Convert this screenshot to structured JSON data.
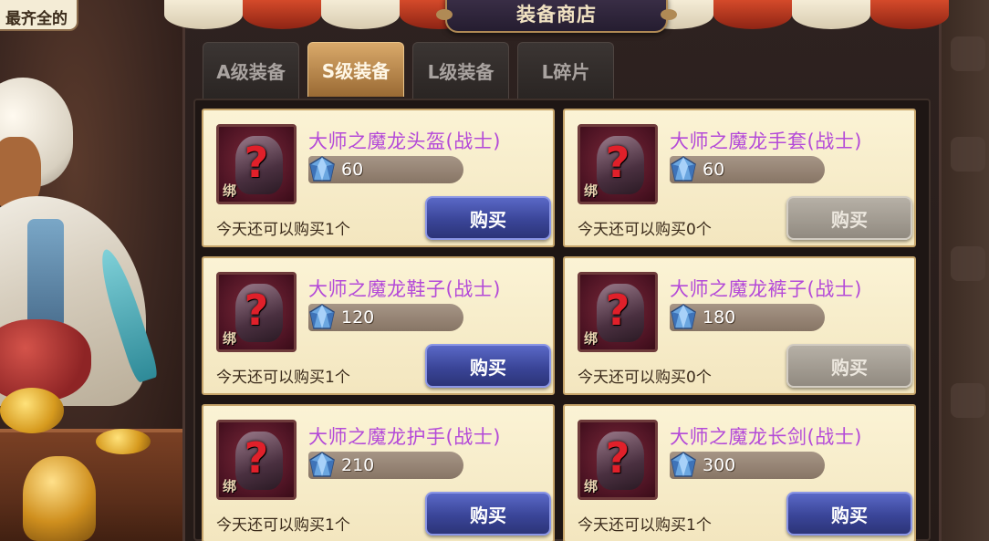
{
  "tooltip": "最齐全的",
  "title": "装备商店",
  "tabs": [
    {
      "label": "A级装备",
      "active": false
    },
    {
      "label": "S级装备",
      "active": true
    },
    {
      "label": "L级装备",
      "active": false
    },
    {
      "label": "L碎片",
      "active": false
    }
  ],
  "bind_label": "绑",
  "currency_icon": "crystal-gem-icon",
  "items": [
    {
      "name": "大师之魔龙头盔(战士)",
      "price": "60",
      "limit": "今天还可以购买1个",
      "buy": "购买",
      "enabled": true
    },
    {
      "name": "大师之魔龙手套(战士)",
      "price": "60",
      "limit": "今天还可以购买0个",
      "buy": "购买",
      "enabled": false
    },
    {
      "name": "大师之魔龙鞋子(战士)",
      "price": "120",
      "limit": "今天还可以购买1个",
      "buy": "购买",
      "enabled": true
    },
    {
      "name": "大师之魔龙裤子(战士)",
      "price": "180",
      "limit": "今天还可以购买0个",
      "buy": "购买",
      "enabled": false
    },
    {
      "name": "大师之魔龙护手(战士)",
      "price": "210",
      "limit": "今天还可以购买1个",
      "buy": "购买",
      "enabled": true
    },
    {
      "name": "大师之魔龙长剑(战士)",
      "price": "300",
      "limit": "今天还可以购买1个",
      "buy": "购买",
      "enabled": true
    }
  ],
  "colors": {
    "item_name": "#b44ad8",
    "buy_button": "#3a4598",
    "buy_button_disabled": "#918a80",
    "active_tab": "#d9a96a"
  }
}
